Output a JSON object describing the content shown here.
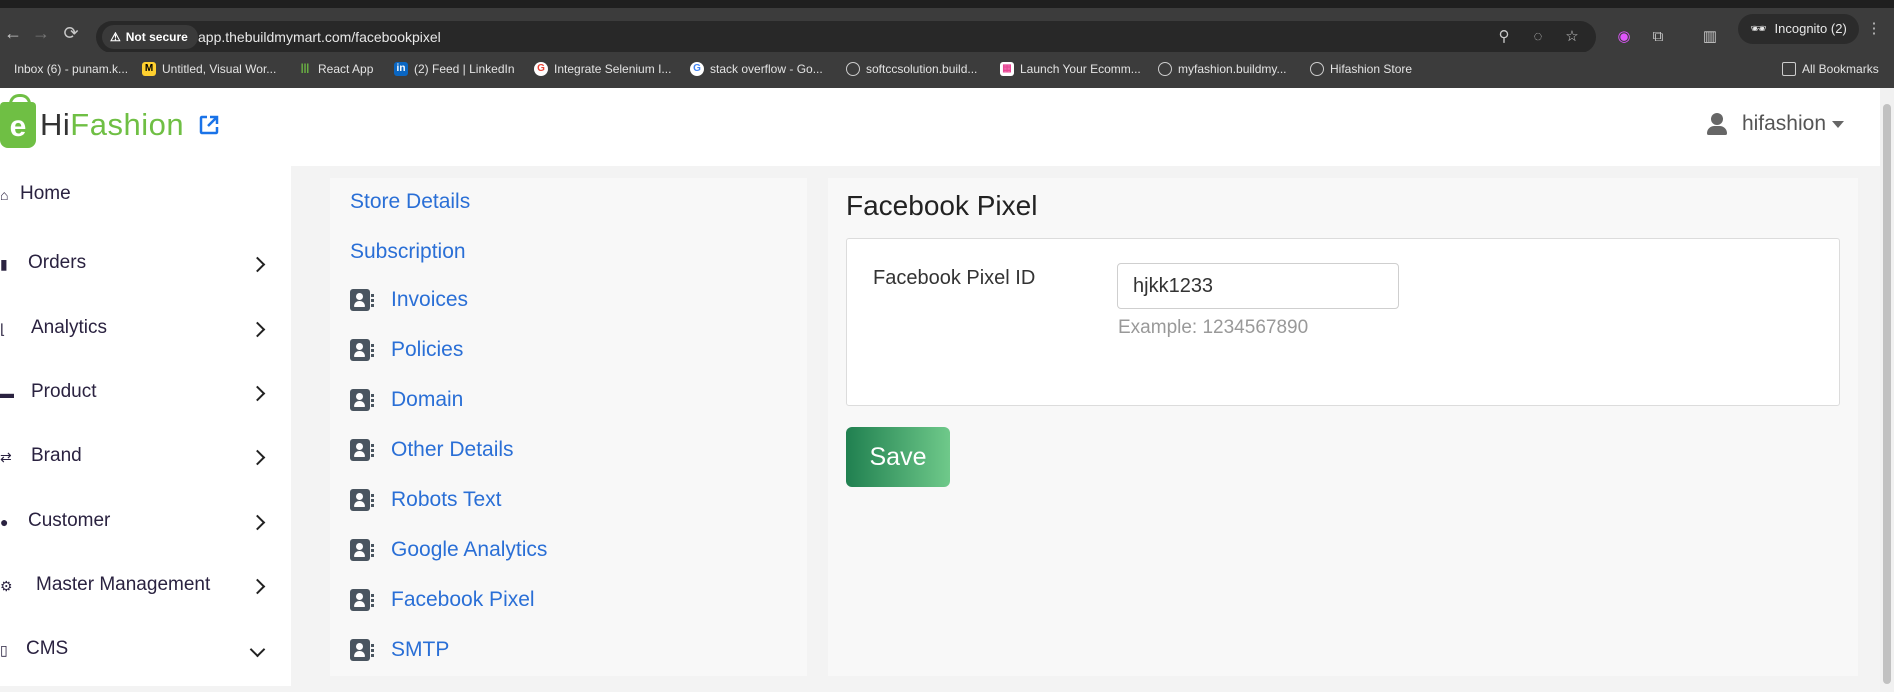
{
  "browser": {
    "not_secure_label": "Not secure",
    "url": "app.thebuildmymart.com/facebookpixel",
    "incognito_label": "Incognito (2)",
    "all_bookmarks_label": "All Bookmarks",
    "bookmarks": [
      {
        "label": "Inbox (6) - punam.k...",
        "icon": "gmail-icon",
        "color": "#d93025"
      },
      {
        "label": "Untitled, Visual Wor...",
        "icon": "miro-icon",
        "color": "#ffd02f"
      },
      {
        "label": "React App",
        "icon": "react-icon",
        "color": "#6fbf44"
      },
      {
        "label": "(2) Feed | LinkedIn",
        "icon": "linkedin-icon",
        "color": "#0a66c2"
      },
      {
        "label": "Integrate Selenium I...",
        "icon": "google-icon",
        "color": "#ea4335"
      },
      {
        "label": "stack overflow - Go...",
        "icon": "google-icon",
        "color": "#4285f4"
      },
      {
        "label": "softccsolution.build...",
        "icon": "globe-icon",
        "color": "#777777"
      },
      {
        "label": "Launch Your Ecomm...",
        "icon": "store-icon",
        "color": "#e84393"
      },
      {
        "label": "myfashion.buildmy...",
        "icon": "globe-icon",
        "color": "#777777"
      },
      {
        "label": "Hifashion Store",
        "icon": "globe-icon",
        "color": "#777777"
      }
    ]
  },
  "header": {
    "logo_hi": "Hi",
    "logo_fashion": "Fashion",
    "logo_bag_letter": "e",
    "username": "hifashion"
  },
  "sidebar": {
    "items": [
      {
        "label": "Home",
        "icon": "home-icon"
      },
      {
        "label": "Orders",
        "icon": "bag-icon"
      },
      {
        "label": "Analytics",
        "icon": "chart-icon"
      },
      {
        "label": "Product",
        "icon": "box-icon"
      },
      {
        "label": "Brand",
        "icon": "shuffle-icon"
      },
      {
        "label": "Customer",
        "icon": "person-icon"
      },
      {
        "label": "Master Management",
        "icon": "user-gear-icon"
      },
      {
        "label": "CMS",
        "icon": "file-icon"
      }
    ]
  },
  "submenu": {
    "store_details": "Store Details",
    "subscription": "Subscription",
    "items": [
      "Invoices",
      "Policies",
      "Domain",
      "Other Details",
      "Robots Text",
      "Google Analytics",
      "Facebook Pixel",
      "SMTP"
    ]
  },
  "main": {
    "title": "Facebook Pixel",
    "field_label": "Facebook Pixel ID",
    "field_value": "hjkk1233",
    "field_help": "Example: 1234567890",
    "save_label": "Save"
  }
}
